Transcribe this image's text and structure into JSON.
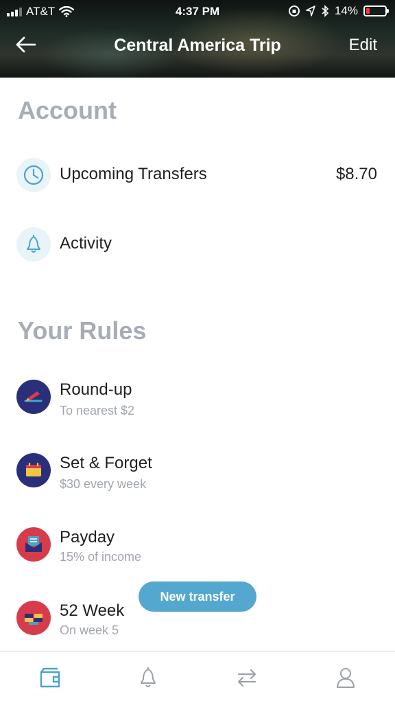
{
  "status_bar": {
    "carrier": "AT&T",
    "time": "4:37 PM",
    "battery_percent": "14%",
    "battery_color": "#ff3b30"
  },
  "nav": {
    "back_icon": "back-arrow-icon",
    "title": "Central America Trip",
    "edit_label": "Edit"
  },
  "account": {
    "title": "Account",
    "items": [
      {
        "label": "Upcoming Transfers",
        "amount": "$8.70",
        "icon": "clock-icon"
      },
      {
        "label": "Activity",
        "icon": "bell-icon"
      }
    ]
  },
  "rules": {
    "title": "Your Rules",
    "items": [
      {
        "label": "Round-up",
        "subtitle": "To nearest $2",
        "icon": "round-up-icon",
        "color": "#2a2f7a"
      },
      {
        "label": "Set & Forget",
        "subtitle": "$30 every week",
        "icon": "calendar-icon",
        "color": "#2a2f7a"
      },
      {
        "label": "Payday",
        "subtitle": "15% of income",
        "icon": "envelope-icon",
        "color": "#d63c4c"
      },
      {
        "label": "52 Week",
        "subtitle": "On week 5",
        "icon": "fifty-two-icon",
        "color": "#d63c4c"
      }
    ]
  },
  "new_transfer_label": "New transfer",
  "accent_color": "#54a7cf",
  "tabbar": {
    "items": [
      "wallet-icon",
      "bell-icon",
      "transfer-icon",
      "profile-icon"
    ]
  }
}
